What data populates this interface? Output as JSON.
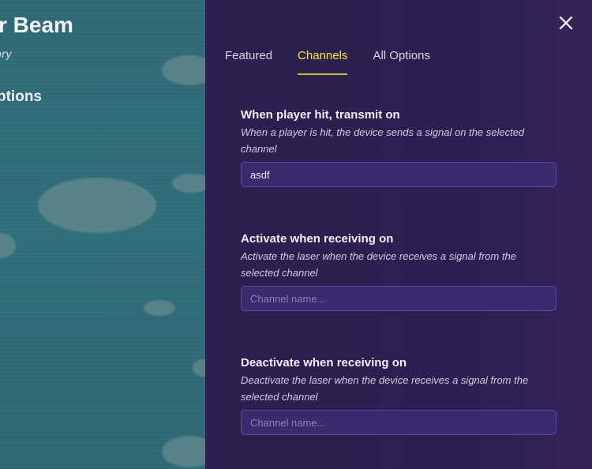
{
  "left": {
    "title": "r Beam",
    "subtitle": "ory",
    "options_heading": "ptions"
  },
  "panel": {
    "close_icon": "close-icon",
    "tabs": [
      {
        "label": "Featured",
        "active": false
      },
      {
        "label": "Channels",
        "active": true
      },
      {
        "label": "All Options",
        "active": false
      }
    ],
    "sections": [
      {
        "title": "When player hit, transmit on",
        "description": "When a player is hit, the device sends a signal on the selected channel",
        "value": "asdf",
        "placeholder": ""
      },
      {
        "title": "Activate when receiving on",
        "description": "Activate the laser when the device receives a signal from the selected channel",
        "value": "",
        "placeholder": "Channel name..."
      },
      {
        "title": "Deactivate when receiving on",
        "description": "Deactivate the laser when the device receives a signal from the selected channel",
        "value": "",
        "placeholder": "Channel name..."
      }
    ]
  },
  "colors": {
    "accent_active_tab": "#f5ea2a",
    "panel_bg": "#2d1f52",
    "field_bg": "#3a2a6e"
  }
}
